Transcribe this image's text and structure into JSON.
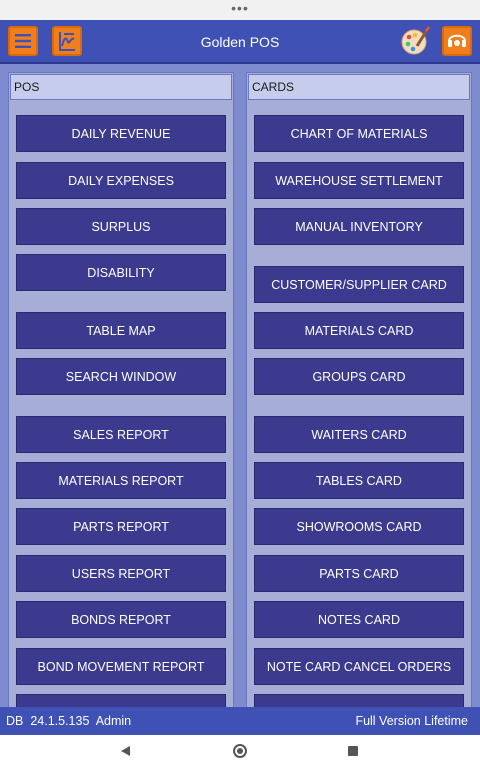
{
  "status_bar": {
    "indicator": "•••"
  },
  "app_bar": {
    "title": "Golden POS",
    "icons": [
      "menu-icon",
      "signature-icon",
      "palette-icon",
      "support-icon"
    ]
  },
  "pos": {
    "header": "POS",
    "items": [
      "DAILY REVENUE",
      "DAILY EXPENSES",
      "SURPLUS",
      "DISABILITY",
      "TABLE MAP",
      "SEARCH WINDOW",
      "SALES REPORT",
      "MATERIALS REPORT",
      "PARTS REPORT",
      "USERS REPORT",
      "BONDS REPORT",
      "BOND MOVEMENT REPORT"
    ]
  },
  "cards": {
    "header": "CARDS",
    "items": [
      "CHART OF MATERIALS",
      "WAREHOUSE SETTLEMENT",
      "MANUAL INVENTORY",
      "CUSTOMER/SUPPLIER CARD",
      "MATERIALS CARD",
      "GROUPS CARD",
      "WAITERS CARD",
      "TABLES CARD",
      "SHOWROOMS CARD",
      "PARTS CARD",
      "NOTES CARD",
      "NOTE CARD CANCEL ORDERS"
    ]
  },
  "footer": {
    "db_label": "DB",
    "version": "24.1.5.135",
    "user": "Admin",
    "license": "Full Version Lifetime"
  },
  "colors": {
    "app_bar": "#3f51b5",
    "background": "#7f8bcf",
    "panel": "#a6aed8",
    "button": "#3b3a8e",
    "accent_orange": "#f07e1c"
  }
}
